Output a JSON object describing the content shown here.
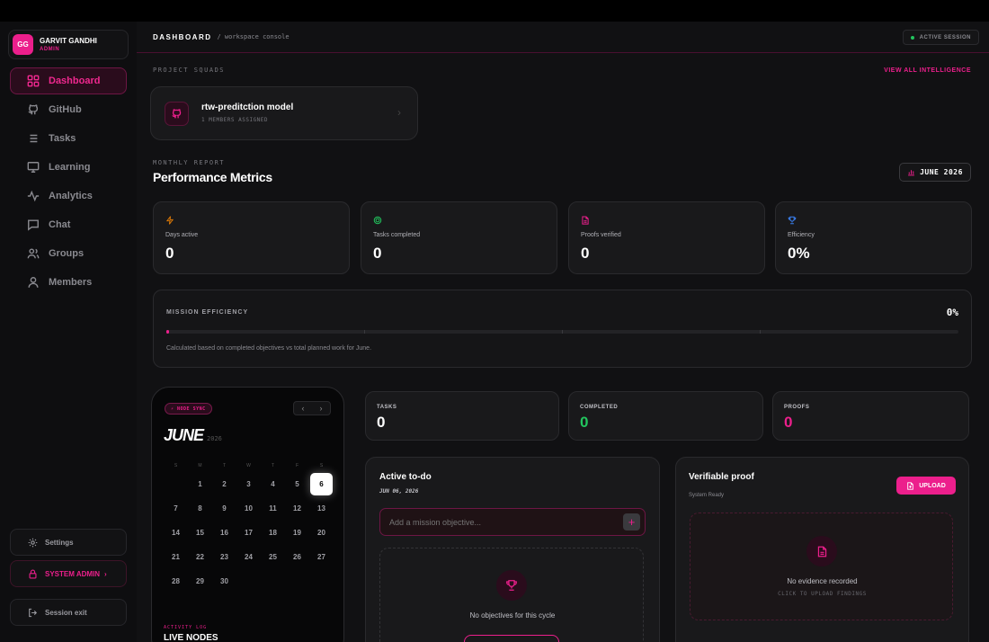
{
  "user": {
    "initials": "GG",
    "name": "GARVIT GANDHI",
    "role": "ADMIN"
  },
  "nav": [
    {
      "label": "Dashboard",
      "icon": "grid-icon",
      "active": true
    },
    {
      "label": "GitHub",
      "icon": "github-icon"
    },
    {
      "label": "Tasks",
      "icon": "list-icon"
    },
    {
      "label": "Learning",
      "icon": "monitor-icon"
    },
    {
      "label": "Analytics",
      "icon": "activity-icon"
    },
    {
      "label": "Chat",
      "icon": "chat-icon"
    },
    {
      "label": "Groups",
      "icon": "users-icon"
    },
    {
      "label": "Members",
      "icon": "user-icon"
    }
  ],
  "sidebar_bottom": {
    "settings": "Settings",
    "admin": "SYSTEM ADMIN",
    "admin_chevron": "›",
    "exit": "Session exit"
  },
  "header": {
    "title": "DASHBOARD",
    "subtitle": "/ workspace console",
    "session": "ACTIVE SESSION"
  },
  "squads": {
    "label": "PROJECT SQUADS",
    "link": "VIEW ALL INTELLIGENCE",
    "card": {
      "name": "rtw-preditction model",
      "members": "1 MEMBERS ASSIGNED",
      "chevron": "›"
    }
  },
  "report": {
    "label": "MONTHLY REPORT",
    "title": "Performance Metrics",
    "month_button": "JUNE 2026"
  },
  "metrics": [
    {
      "label": "Days active",
      "value": "0",
      "icon": "bolt-icon",
      "color": "#d97706"
    },
    {
      "label": "Tasks completed",
      "value": "0",
      "icon": "target-icon",
      "color": "#22c55e"
    },
    {
      "label": "Proofs verified",
      "value": "0",
      "icon": "file-icon",
      "color": "#ec1f8c"
    },
    {
      "label": "Efficiency",
      "value": "0%",
      "icon": "trophy-icon",
      "color": "#3b82f6"
    }
  ],
  "mission": {
    "label": "MISSION EFFICIENCY",
    "value": "0%",
    "progress": 0,
    "note": "Calculated based on completed objectives vs total planned work for June."
  },
  "calendar": {
    "badge": "⚡ NODE SYNC",
    "prev": "‹",
    "next": "›",
    "month": "JUNE",
    "year": "2026",
    "weekdays": [
      "S",
      "M",
      "T",
      "W",
      "T",
      "F",
      "S"
    ],
    "days": [
      "",
      "1",
      "2",
      "3",
      "4",
      "5",
      "6",
      "7",
      "8",
      "9",
      "10",
      "11",
      "12",
      "13",
      "14",
      "15",
      "16",
      "17",
      "18",
      "19",
      "20",
      "21",
      "22",
      "23",
      "24",
      "25",
      "26",
      "27",
      "28",
      "29",
      "30"
    ],
    "selected": "6",
    "activity_label": "ACTIVITY LOG",
    "activity_title": "LIVE NODES"
  },
  "stats": [
    {
      "label": "TASKS",
      "value": "0",
      "color": "#ffffff"
    },
    {
      "label": "COMPLETED",
      "value": "0",
      "color": "#22c55e"
    },
    {
      "label": "PROOFS",
      "value": "0",
      "color": "#ec1f8c"
    }
  ],
  "todo": {
    "title": "Active to-do",
    "date": "JUN 06, 2026",
    "placeholder": "Add a mission objective...",
    "add": "+",
    "empty": "No objectives for this cycle"
  },
  "proof": {
    "title": "Verifiable proof",
    "status": "System Ready",
    "upload": "UPLOAD",
    "empty_title": "No evidence recorded",
    "empty_sub": "CLICK TO UPLOAD FINDINGS"
  }
}
